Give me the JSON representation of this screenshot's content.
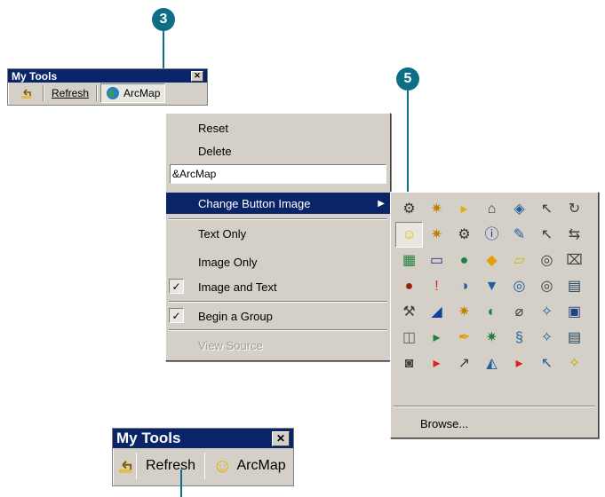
{
  "callouts": {
    "step_a": "3",
    "step_b": "5"
  },
  "toolbar_top": {
    "title": "My Tools",
    "close_glyph": "✕",
    "up_icon": "folder-up-icon",
    "refresh_label": "Refresh",
    "arcmap_label": "ArcMap",
    "arcmap_icon": "globe-icon"
  },
  "context_menu": {
    "reset": "Reset",
    "delete": "Delete",
    "name_field_value": "&ArcMap",
    "change_button_image": "Change Button Image",
    "submenu_arrow": "▶",
    "text_only": "Text Only",
    "image_only": "Image Only",
    "image_and_text": "Image and Text",
    "begin_group": "Begin a Group",
    "view_source": "View Source",
    "check_glyph": "✓"
  },
  "image_palette": {
    "rows": [
      [
        "⚙",
        "✷",
        "▸",
        "⌂",
        "◈",
        "↖",
        "↻"
      ],
      [
        "☺",
        "✷",
        "⚙",
        "ⓘ",
        "✎",
        "↖",
        "⇆"
      ],
      [
        "▦",
        "▭",
        "●",
        "◆",
        "▱",
        "◎",
        "⌧"
      ],
      [
        "●",
        "!",
        "◑",
        "▼",
        "◎",
        "◎",
        "▤"
      ],
      [
        "⚒",
        "◢",
        "✷",
        "◐",
        "⌀",
        "✧",
        "▣"
      ],
      [
        "◫",
        "▸",
        "✒",
        "✷",
        "§",
        "✧",
        "▤"
      ],
      [
        "◙",
        "▸",
        "↗",
        "◭",
        "▸",
        "↖",
        "✧"
      ]
    ],
    "colors": [
      [
        "#333333",
        "#c08000",
        "#e0b000",
        "#404040",
        "#2060a0",
        "#404040",
        "#404040"
      ],
      [
        "#e0c000",
        "#c08000",
        "#333333",
        "#1040a0",
        "#2060a0",
        "#404040",
        "#404040"
      ],
      [
        "#208040",
        "#203080",
        "#208040",
        "#e0a000",
        "#c0c000",
        "#404040",
        "#404040"
      ],
      [
        "#a02010",
        "#e02020",
        "#2060a0",
        "#2060a0",
        "#2060a0",
        "#404040",
        "#204060"
      ],
      [
        "#404040",
        "#1040a0",
        "#c08000",
        "#208040",
        "#404040",
        "#2060a0",
        "#204080"
      ],
      [
        "#606060",
        "#208040",
        "#e0a000",
        "#208040",
        "#2060a0",
        "#2060a0",
        "#204060"
      ],
      [
        "#404040",
        "#e02020",
        "#404040",
        "#2060a0",
        "#e02020",
        "#2060a0",
        "#c0a000"
      ]
    ],
    "browse_label": "Browse..."
  },
  "toolbar_bottom": {
    "title": "My Tools",
    "close_glyph": "✕",
    "refresh_label": "Refresh",
    "arcmap_label": "ArcMap",
    "arcmap_icon": "smiley-icon",
    "smiley_glyph": "☺"
  }
}
